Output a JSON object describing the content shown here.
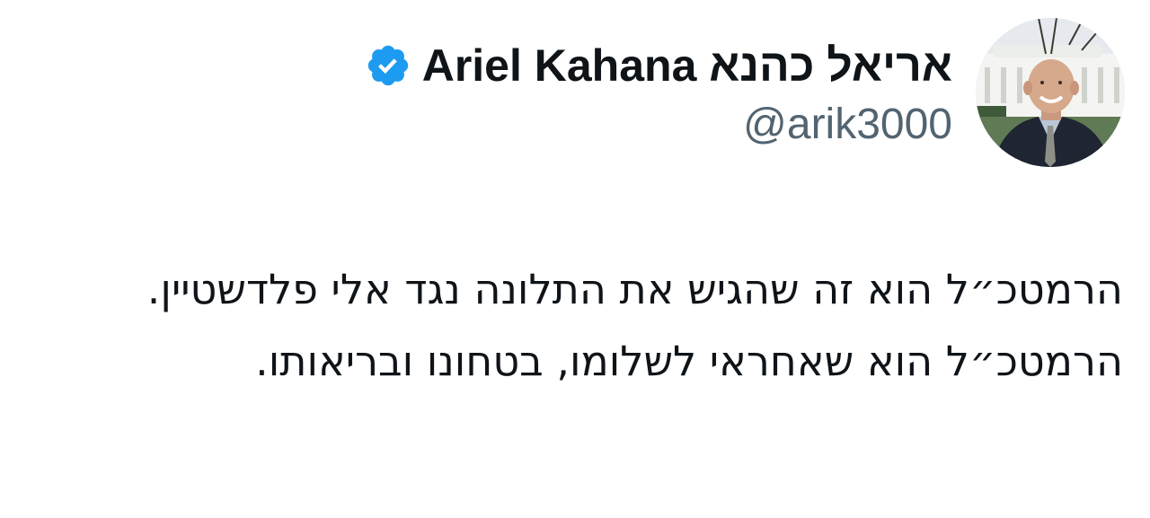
{
  "author": {
    "display_name": "אריאל כהנא Ariel Kahana",
    "handle": "@arik3000",
    "verified": true,
    "verified_color": "#1d9bf0",
    "avatar_icon": "profile-photo"
  },
  "tweet": {
    "lines": [
      "הרמטכ״ל הוא זה שהגיש את התלונה נגד אלי פלדשטיין.",
      "הרמטכ״ל הוא שאחראי לשלומו, בטחונו ובריאותו."
    ]
  },
  "colors": {
    "text": "#0f1419",
    "secondary_text": "#536471",
    "background": "#ffffff"
  }
}
